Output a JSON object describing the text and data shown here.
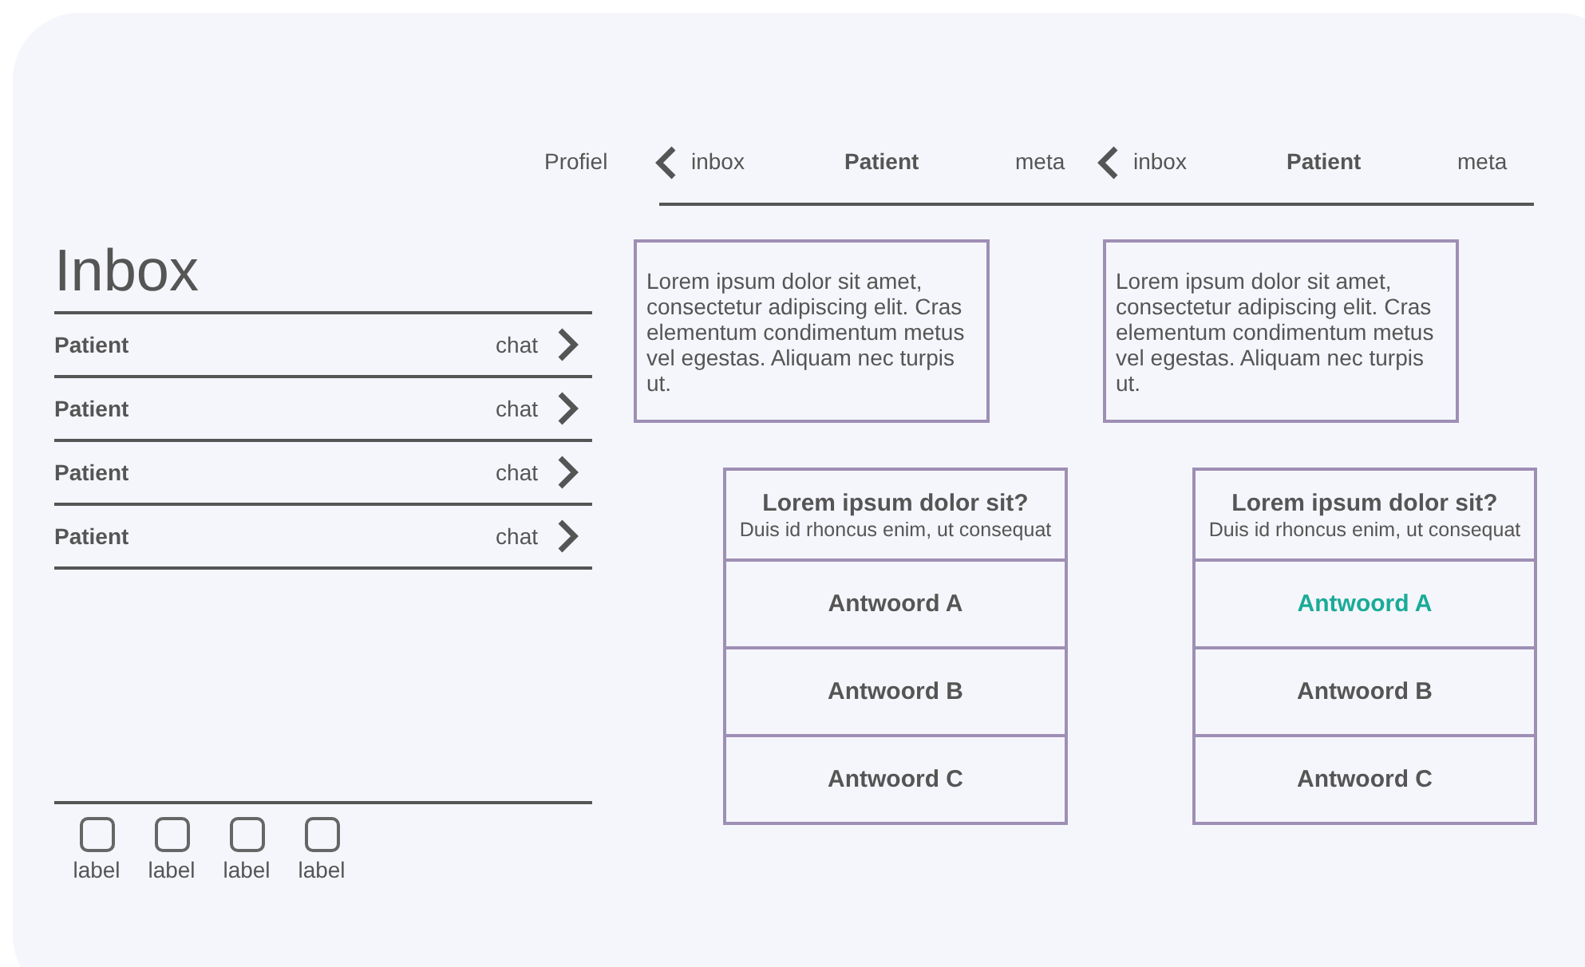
{
  "header": {
    "profile": "Profiel",
    "screens": [
      {
        "back": "inbox",
        "title": "Patient",
        "meta": "meta"
      },
      {
        "back": "inbox",
        "title": "Patient",
        "meta": "meta"
      }
    ]
  },
  "inbox": {
    "title": "Inbox",
    "rows": [
      {
        "name": "Patient",
        "action": "chat"
      },
      {
        "name": "Patient",
        "action": "chat"
      },
      {
        "name": "Patient",
        "action": "chat"
      },
      {
        "name": "Patient",
        "action": "chat"
      }
    ]
  },
  "tab_bar": [
    {
      "label": "label"
    },
    {
      "label": "label"
    },
    {
      "label": "label"
    },
    {
      "label": "label"
    }
  ],
  "screens": [
    {
      "text": "Lorem ipsum dolor sit amet, consectetur adipiscing elit. Cras elementum condimentum metus vel egestas. Aliquam nec turpis ut.",
      "question": {
        "title": "Lorem ipsum dolor sit?",
        "subtitle": "Duis id rhoncus enim, ut consequat"
      },
      "answers": [
        {
          "label": "Antwoord A",
          "selected": false
        },
        {
          "label": "Antwoord B",
          "selected": false
        },
        {
          "label": "Antwoord C",
          "selected": false
        }
      ]
    },
    {
      "text": "Lorem ipsum dolor sit amet, consectetur adipiscing elit. Cras elementum condimentum metus vel egestas. Aliquam nec turpis ut.",
      "question": {
        "title": "Lorem ipsum dolor sit?",
        "subtitle": "Duis id rhoncus enim, ut consequat"
      },
      "answers": [
        {
          "label": "Antwoord A",
          "selected": true
        },
        {
          "label": "Antwoord B",
          "selected": false
        },
        {
          "label": "Antwoord C",
          "selected": false
        }
      ]
    }
  ]
}
